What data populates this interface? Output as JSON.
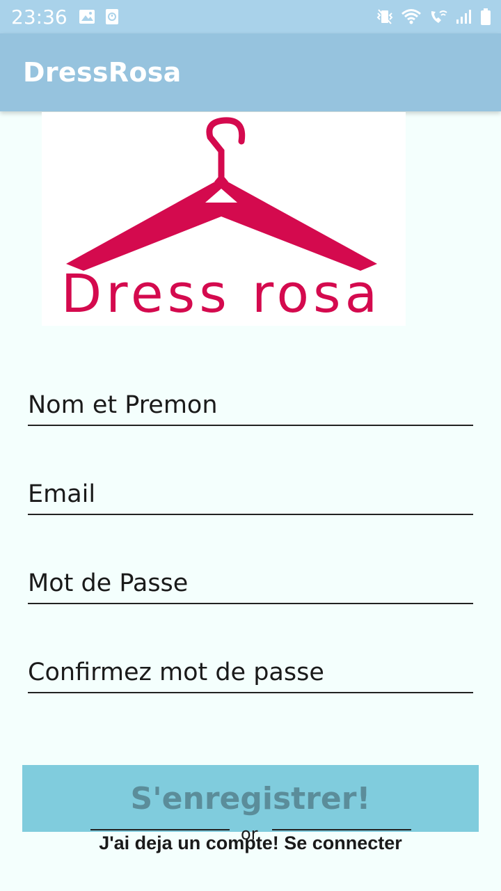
{
  "status_bar": {
    "time": "23:36",
    "icons_left": [
      "image-icon",
      "clock-badge-icon"
    ],
    "icons_right": [
      "vibrate-icon",
      "wifi-icon",
      "wifi-call-icon",
      "signal-icon",
      "battery-icon"
    ]
  },
  "app_bar": {
    "title": "DressRosa"
  },
  "logo": {
    "text": "Dress rosa",
    "icon": "hanger-icon",
    "color": "#d40a4e"
  },
  "form": {
    "name_placeholder": "Nom et Premon",
    "email_placeholder": "Email",
    "password_placeholder": "Mot de Passe",
    "confirm_password_placeholder": "Confirmez mot de passe"
  },
  "register_button": {
    "label": "S'enregistrer!"
  },
  "divider": {
    "label": "or"
  },
  "login_link": {
    "label": "J'ai deja un compte! Se connecter"
  },
  "colors": {
    "status_bar": "#a9d2ea",
    "app_bar": "#96c3de",
    "button": "#80ccdd",
    "button_text": "#5b8d9a",
    "background": "#f4fffd"
  }
}
